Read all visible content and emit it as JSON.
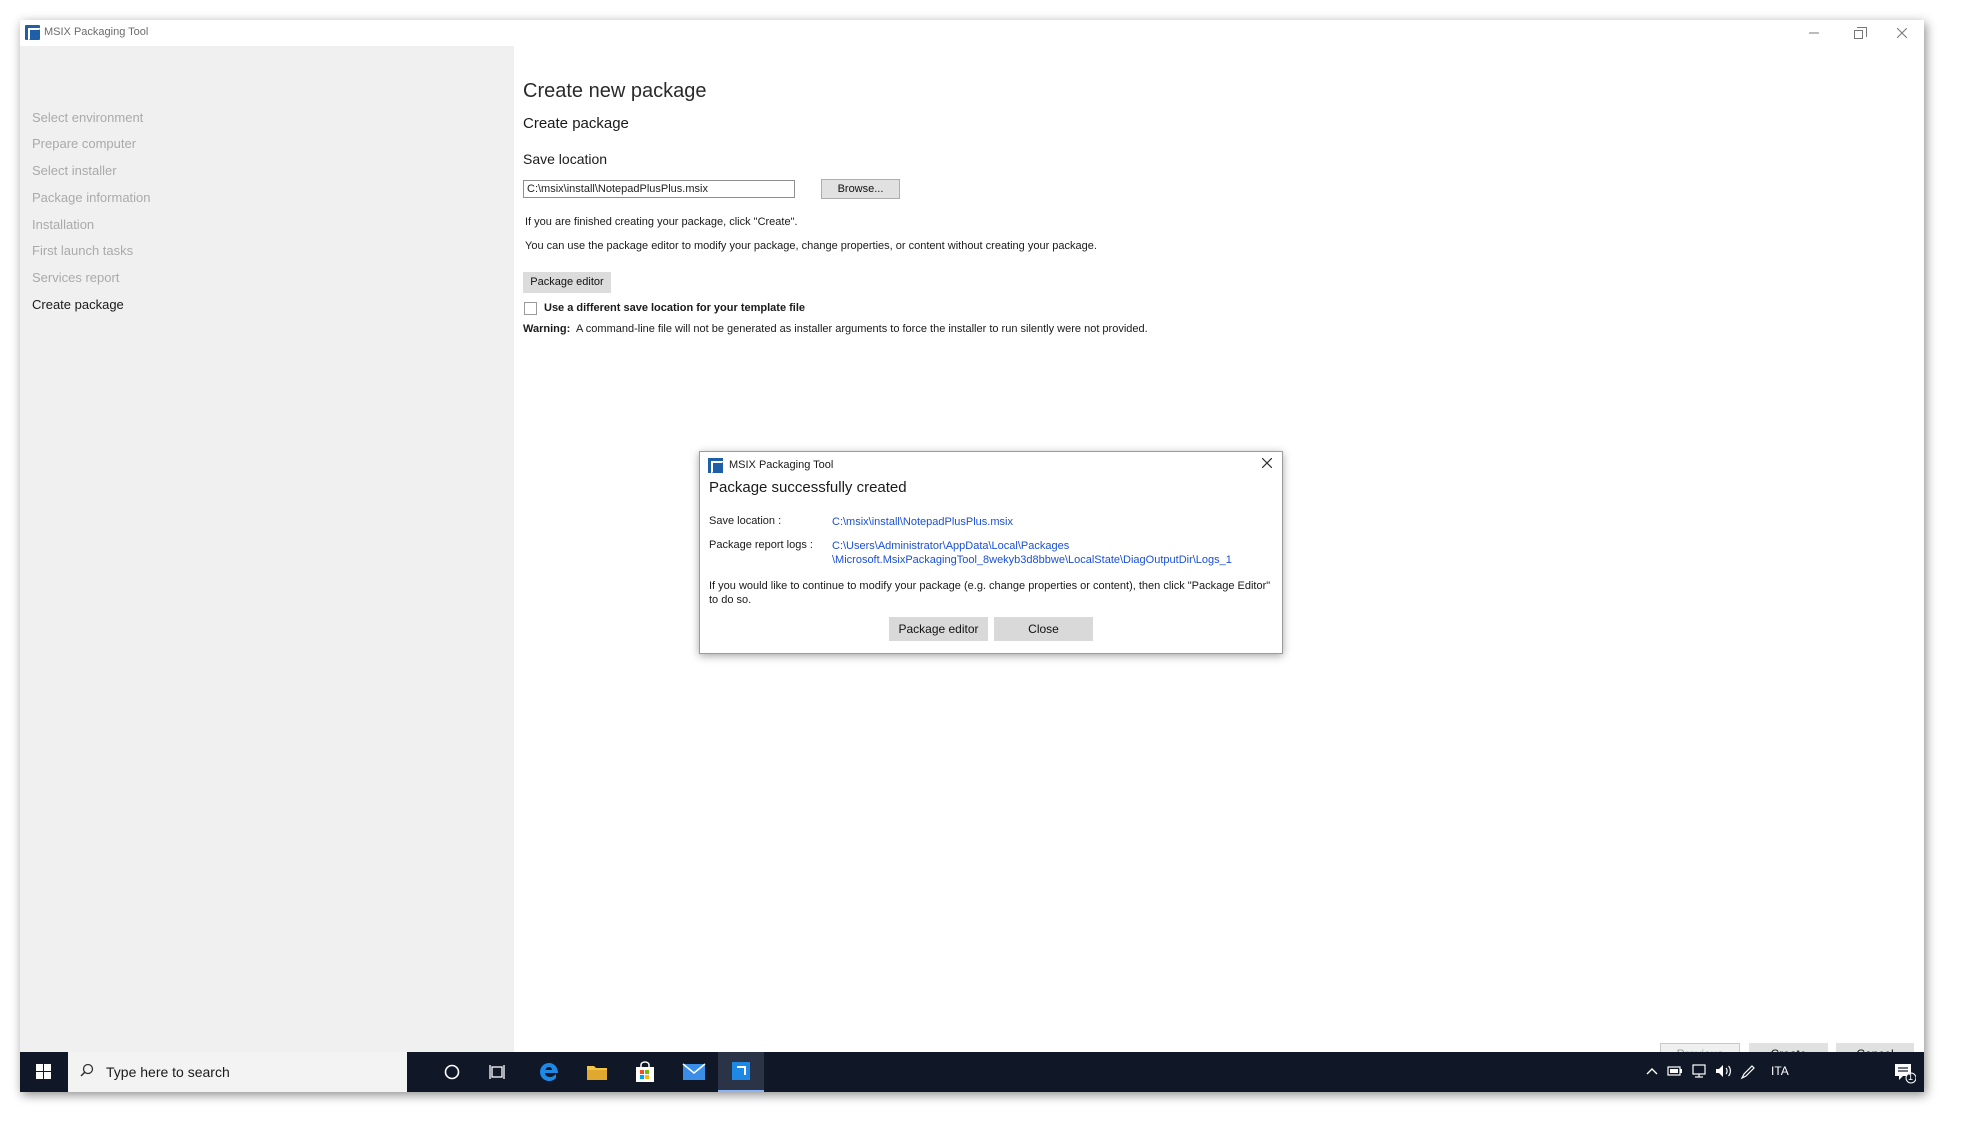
{
  "window": {
    "title": "MSIX Packaging Tool"
  },
  "sidebar": {
    "items": [
      {
        "label": "Select environment",
        "active": false
      },
      {
        "label": "Prepare computer",
        "active": false
      },
      {
        "label": "Select installer",
        "active": false
      },
      {
        "label": "Package information",
        "active": false
      },
      {
        "label": "Installation",
        "active": false
      },
      {
        "label": "First launch tasks",
        "active": false
      },
      {
        "label": "Services report",
        "active": false
      },
      {
        "label": "Create package",
        "active": true
      }
    ]
  },
  "main": {
    "title": "Create new package",
    "subtitle": "Create package",
    "save_location_label": "Save location",
    "save_location_value": "C:\\msix\\install\\NotepadPlusPlus.msix",
    "browse_label": "Browse...",
    "info_line1": "If you are finished creating your package, click \"Create\".",
    "info_line2": "You can use the package editor to modify your package, change properties, or content without creating your package.",
    "package_editor_label": "Package editor",
    "template_checkbox_label": "Use a different save location for your template file",
    "template_checkbox_checked": false,
    "warning_label": "Warning:",
    "warning_text": "A command-line file will not be generated as installer arguments to force the installer to run silently were not provided."
  },
  "footer": {
    "previous_label": "Previous",
    "create_label": "Create",
    "cancel_label": "Cancel"
  },
  "dialog": {
    "title": "MSIX Packaging Tool",
    "heading": "Package successfully created",
    "save_location_label": "Save location :",
    "save_location_link": "C:\\msix\\install\\NotepadPlusPlus.msix",
    "report_logs_label": "Package report logs :",
    "report_logs_link_line1": "C:\\Users\\Administrator\\AppData\\Local\\Packages",
    "report_logs_link_line2": "\\Microsoft.MsixPackagingTool_8wekyb3d8bbwe\\LocalState\\DiagOutputDir\\Logs_1",
    "message": "If you would like to continue to modify your package (e.g. change properties or content), then click \"Package Editor\" to do so.",
    "package_editor_label": "Package editor",
    "close_label": "Close"
  },
  "taskbar": {
    "search_placeholder": "Type here to search",
    "language": "ITA",
    "notification_count": "1",
    "pinned_icons": [
      "cortana-icon",
      "task-view-icon",
      "edge-icon",
      "file-explorer-icon",
      "store-icon",
      "mail-icon",
      "msix-packaging-tool-icon"
    ]
  },
  "colors": {
    "sidebar_bg": "#f0f0f0",
    "nav_inactive": "#aaaaaa",
    "link": "#1a4fd6",
    "taskbar_bg": "#101828",
    "brand": "#1f5fa8"
  }
}
